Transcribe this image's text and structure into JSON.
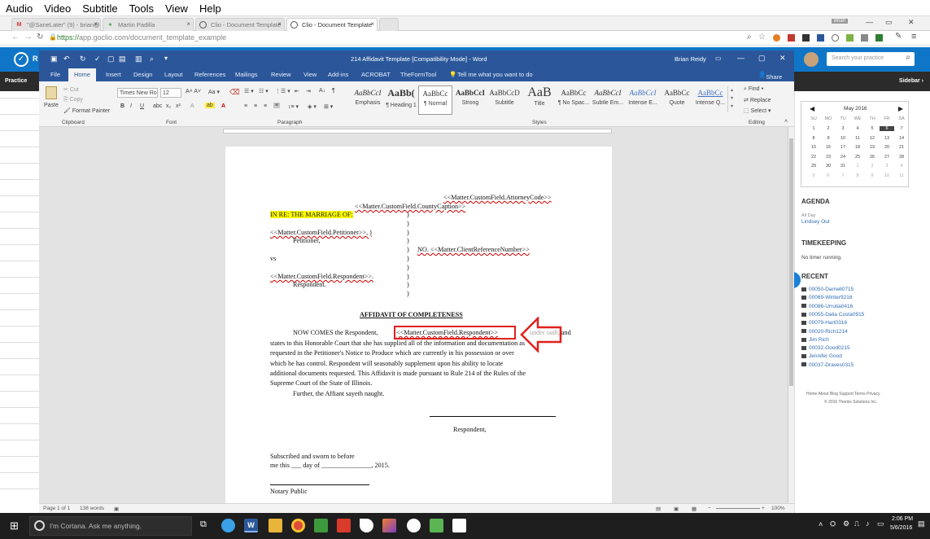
{
  "vlc_menu": [
    "Audio",
    "Video",
    "Subtitle",
    "Tools",
    "View",
    "Help"
  ],
  "browser": {
    "tabs": [
      {
        "label": "\"@SaneLater\" (9) - brian@",
        "active": false
      },
      {
        "label": "Martin Padilla",
        "active": false
      },
      {
        "label": "Clio - Document Template",
        "active": false
      },
      {
        "label": "Clio - Document Template",
        "active": true
      }
    ],
    "user_badge": "Brian",
    "url_scheme": "https://",
    "url_rest": "app.goclio.com/document_template_example"
  },
  "clio": {
    "search_placeholder": "Search your practice",
    "practice_label": "Practice",
    "sidebar_label": "Sidebar ›"
  },
  "word": {
    "title": "214 Affidavit Template [Compatibility Mode] - Word",
    "user": "Brian Reidy",
    "share": "Share",
    "tabs": [
      "File",
      "Home",
      "Insert",
      "Design",
      "Layout",
      "References",
      "Mailings",
      "Review",
      "View",
      "Add-ins",
      "ACROBAT",
      "TheFormTool"
    ],
    "tell_me": "Tell me what you want to do",
    "clipboard": {
      "paste": "Paste",
      "cut": "Cut",
      "copy": "Copy",
      "format_painter": "Format Painter",
      "group": "Clipboard"
    },
    "font": {
      "name": "Times New Ro",
      "size": "12",
      "group": "Font"
    },
    "paragraph_group": "Paragraph",
    "styles_group": "Styles",
    "editing": {
      "find": "Find",
      "replace": "Replace",
      "select": "Select",
      "group": "Editing"
    },
    "styles": [
      {
        "sample": "AaBbCcI",
        "name": "Emphasis"
      },
      {
        "sample": "AaBb(",
        "name": "¶ Heading 1"
      },
      {
        "sample": "AaBbCc",
        "name": "¶ Normal"
      },
      {
        "sample": "AaBbCcI",
        "name": "Strong"
      },
      {
        "sample": "AaBbCcD",
        "name": "Subtitle"
      },
      {
        "sample": "AaB",
        "name": "Title"
      },
      {
        "sample": "AaBbCc",
        "name": "¶ No Spac..."
      },
      {
        "sample": "AaBbCcI",
        "name": "Subtle Em..."
      },
      {
        "sample": "AaBbCcI",
        "name": "Intense E..."
      },
      {
        "sample": "AaBbCc",
        "name": "Quote"
      },
      {
        "sample": "AaBbCc",
        "name": "Intense Q..."
      }
    ],
    "status": {
      "page": "Page 1 of 1",
      "words": "138 words",
      "zoom": "100%"
    }
  },
  "document": {
    "attorney_code": "<<Matter.CustomField.AttorneyCode>>",
    "county_caption": "<<Matter.CustomField.CountyCaption>>",
    "in_re": "IN RE: THE MARRIAGE OF:",
    "petitioner_field": "<<Matter.CustomField.Petitioner>>, )",
    "petitioner_label": "Petitioner,",
    "no_line": "NO. <<Matter.ClientReferenceNumber>>",
    "vs": "vs",
    "respondent_field": "<<Matter.CustomField.Respondent>>.",
    "respondent_label": "Respondent.",
    "heading": "AFFIDAVIT OF COMPLETENESS",
    "body_start": "NOW COMES the Respondent,",
    "body_field": "<<Matter.CustomField.Respondent>>",
    "body_after": "under oath, and",
    "body_lines": [
      "states to this Honorable Court that she has supplied all of the information and documentation as",
      "requested in the Petitioner's Notice to Produce which are currently in his possession or over",
      "which he has control. Respondent will seasonably supplement upon his ability to locate",
      "additional documents requested. This Affidavit is made pursuant to Rule 214 of the Rules of the",
      "Supreme Court of the State of Illinois."
    ],
    "further": "Further, the Affiant sayeth naught.",
    "sig_label": "Respondent,",
    "subscribed": "Subscribed and sworn to before",
    "me_this": "me this ___ day of _______________, 2015.",
    "notary": "Notary Public"
  },
  "right_panel": {
    "month": "May 2016",
    "weekdays": [
      "SU",
      "MO",
      "TU",
      "WE",
      "TH",
      "FR",
      "SA"
    ],
    "weeks": [
      [
        "1",
        "2",
        "3",
        "4",
        "5",
        "6",
        "7"
      ],
      [
        "8",
        "9",
        "10",
        "11",
        "12",
        "13",
        "14"
      ],
      [
        "15",
        "16",
        "17",
        "18",
        "19",
        "20",
        "21"
      ],
      [
        "22",
        "23",
        "24",
        "25",
        "26",
        "27",
        "28"
      ],
      [
        "29",
        "30",
        "31",
        "1",
        "2",
        "3",
        "4"
      ],
      [
        "5",
        "6",
        "7",
        "8",
        "9",
        "10",
        "11"
      ]
    ],
    "agenda_title": "AGENDA",
    "agenda_sub": "All Day",
    "agenda_item": "Lindsey Out",
    "timekeeping_title": "TIMEKEEPING",
    "timekeeping_text": "No timer running.",
    "recent_title": "RECENT",
    "recent": [
      "00050-Darnell0715",
      "00069-Winter9216",
      "00086-Urrutia0416",
      "00055-Dalia Costa0915",
      "00079-Hart0316",
      "00020-Rich1214",
      "Jim Rich",
      "00032-Good0215",
      "Jennifer Good",
      "00037-Draves0315"
    ],
    "footer_links": "Home  About  Blog  Support  Terms  Privacy",
    "footer_copy": "© 2016 Themis Solutions Inc."
  },
  "taskbar": {
    "cortana": "I'm Cortana. Ask me anything.",
    "time": "2:06 PM",
    "date": "5/6/2016"
  },
  "colors": {
    "word_blue": "#2b579a",
    "clio_blue": "#0f76c7",
    "highlight": "#ffff00",
    "annotation_red": "#e0211e"
  }
}
